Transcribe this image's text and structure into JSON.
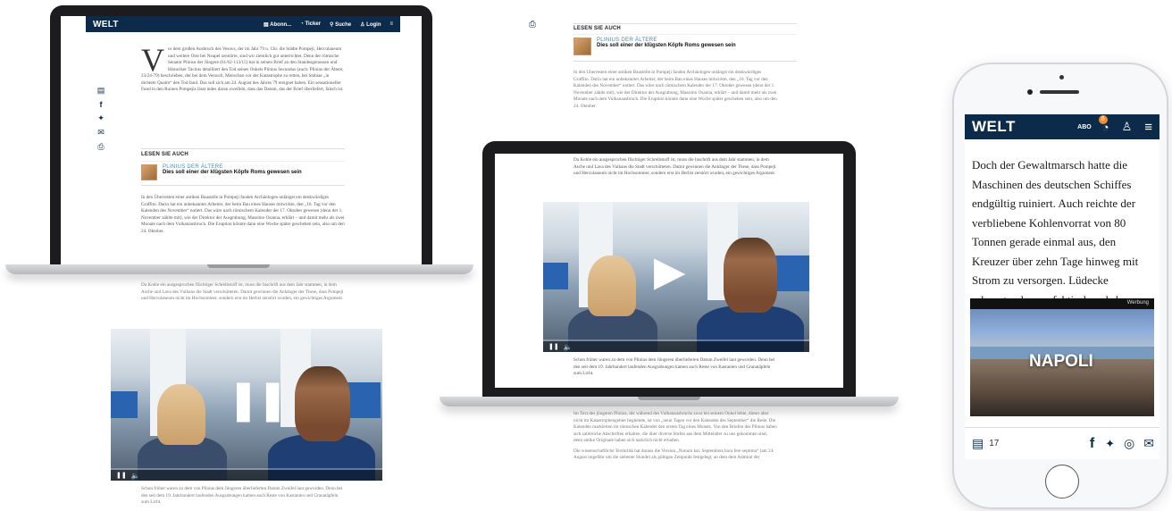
{
  "brand": {
    "logo": "WELT",
    "color_navy": "#0c2b4a",
    "color_link": "#3a8bc7"
  },
  "laptop_nav": {
    "items": [
      {
        "icon": "newspaper-icon",
        "label": "Abonn..."
      },
      {
        "icon": "ticker-icon",
        "label": "Ticker"
      },
      {
        "icon": "search-icon",
        "label": "Suche"
      },
      {
        "icon": "user-icon",
        "label": "Login"
      },
      {
        "icon": "menu-icon",
        "label": "≡"
      }
    ]
  },
  "article": {
    "dropcap": "V",
    "p1": "or dem großen Ausbruch des Vesuvs, der im Jahr 79 n. Chr. die Städte Pompeji, Herculaneum und weitere Orte bei Neapel zerstörte, sind wir ziemlich gut unterrichtet. Denn der römische Senator Plinius der Jüngere (61/62-113/15) hat in seinen Brief an den Standesgenossen und Historiker Tacitus detailliert den Tod seines Onkels Plinius Secundus (auch: Plinius der Ältere, 23/24-79) beschrieben, der bei dem Versuch, Menschen vor der Katastrophe zu retten, bei Stabiae „in dichtem Qualm“ den Tod fand. Das soll sich am 24. August des Jahres 79 ereignet haben. Ein sensationeller Fund in den Ruinen Pompejis lässt indes daran zweifeln, dass das Datum, das der Brief überliefert, falsch ist.",
    "related_header": "LESEN SIE AUCH",
    "related_kicker": "PLINIUS DER ÄLTERE",
    "related_title": "Dies soll einer der klügsten Köpfe Roms gewesen sein",
    "p2": "In den Überresten einer antiken Baustelle in Pompeji fanden Archäologen unlängst ein denkwürdiges Graffito. Darin hat ein unbekannter Arbeiter, der beim Bau eines Hauses mitwirkte, den „16. Tag vor den Kalenden des November“ notiert. Das wäre nach römischem Kalender der 17. Oktober gewesen (denn der 1. November zählte mit), wie der Direktor der Ausgrabung, Massimo Osanna, erklärt – und damit mehr als zwei Monate nach dem Vulkanausbruch. Die Eruption könnte dann eine Woche später geschehen sein, also um den 24. Oktober.",
    "p3": "Da Kohle ein ausgesprochen flüchtiger Schreibstoff ist, muss die Inschrift aus dem Jahr stammen, in dem Asche und Lava des Vulkans die Stadt verschütteten. Damit gewinnen die Anhänger der These, dass Pompeji und Herculaneum nicht im Hochsommer, sondern erst im Herbst zerstört wurden, ein gewichtiges Argument.",
    "p4": "Schon früher waren zu dem von Plinius dem Jüngeren überlieferten Datum Zweifel laut geworden. Denn bei den seit dem 19. Jahrhundert laufenden Ausgrabungen kamen auch Reste von Kastanien und Granatäpfeln zum Licht.",
    "p5": "Im Text des jüngeren Plinius, der während des Vulkanausbruchs zwar bei seinem Onkel lebte, dieser aber nicht im Katastrophengebiet begleitete, ist von „neun Tagen vor den Kalenden des September“ die Rede. Die Kalenden markierten im römischen Kalender den ersten Tag eines Monats. Von den Briefen des Plinius haben sich zahlreiche Abschriften erhalten, die über diverse Stufen aus dem Mittelalter zu uns gekommen sind, denn antike Originale haben sich natürlich nicht erhalten.",
    "p6": "Die wissenschaftliche Textkritik hat daraus die Version „Nonum kal. Septembres hora fere septima“ (am 24. August ungefähr um die siebente Stunde) als gültigen Zeitpunkt festgelegt, an dem dem Admiral der"
  },
  "video": {
    "pause_glyph": "❚❚",
    "volume_glyph": "🔈",
    "play_glyph": "▶"
  },
  "phone": {
    "nav_abo": "ABO",
    "nav_badge": "6",
    "paragraph": "Doch der Gewaltmarsch hatte die Maschinen des deutschen Schiffes endgültig ruiniert. Auch reichte der verbliebene Kohlenvorrat von 80 Tonnen gerade einmal aus, den Kreuzer über zehn Tage hinweg mit Strom zu versorgen. Lüdecke erkannte, dass er faktisch wehrlos war, und erklärte sich und seine Leute als im neutralen Chile interniert.",
    "ad_label": "Werbung",
    "ad_title": "NAPOLI",
    "comment_count": "17"
  }
}
